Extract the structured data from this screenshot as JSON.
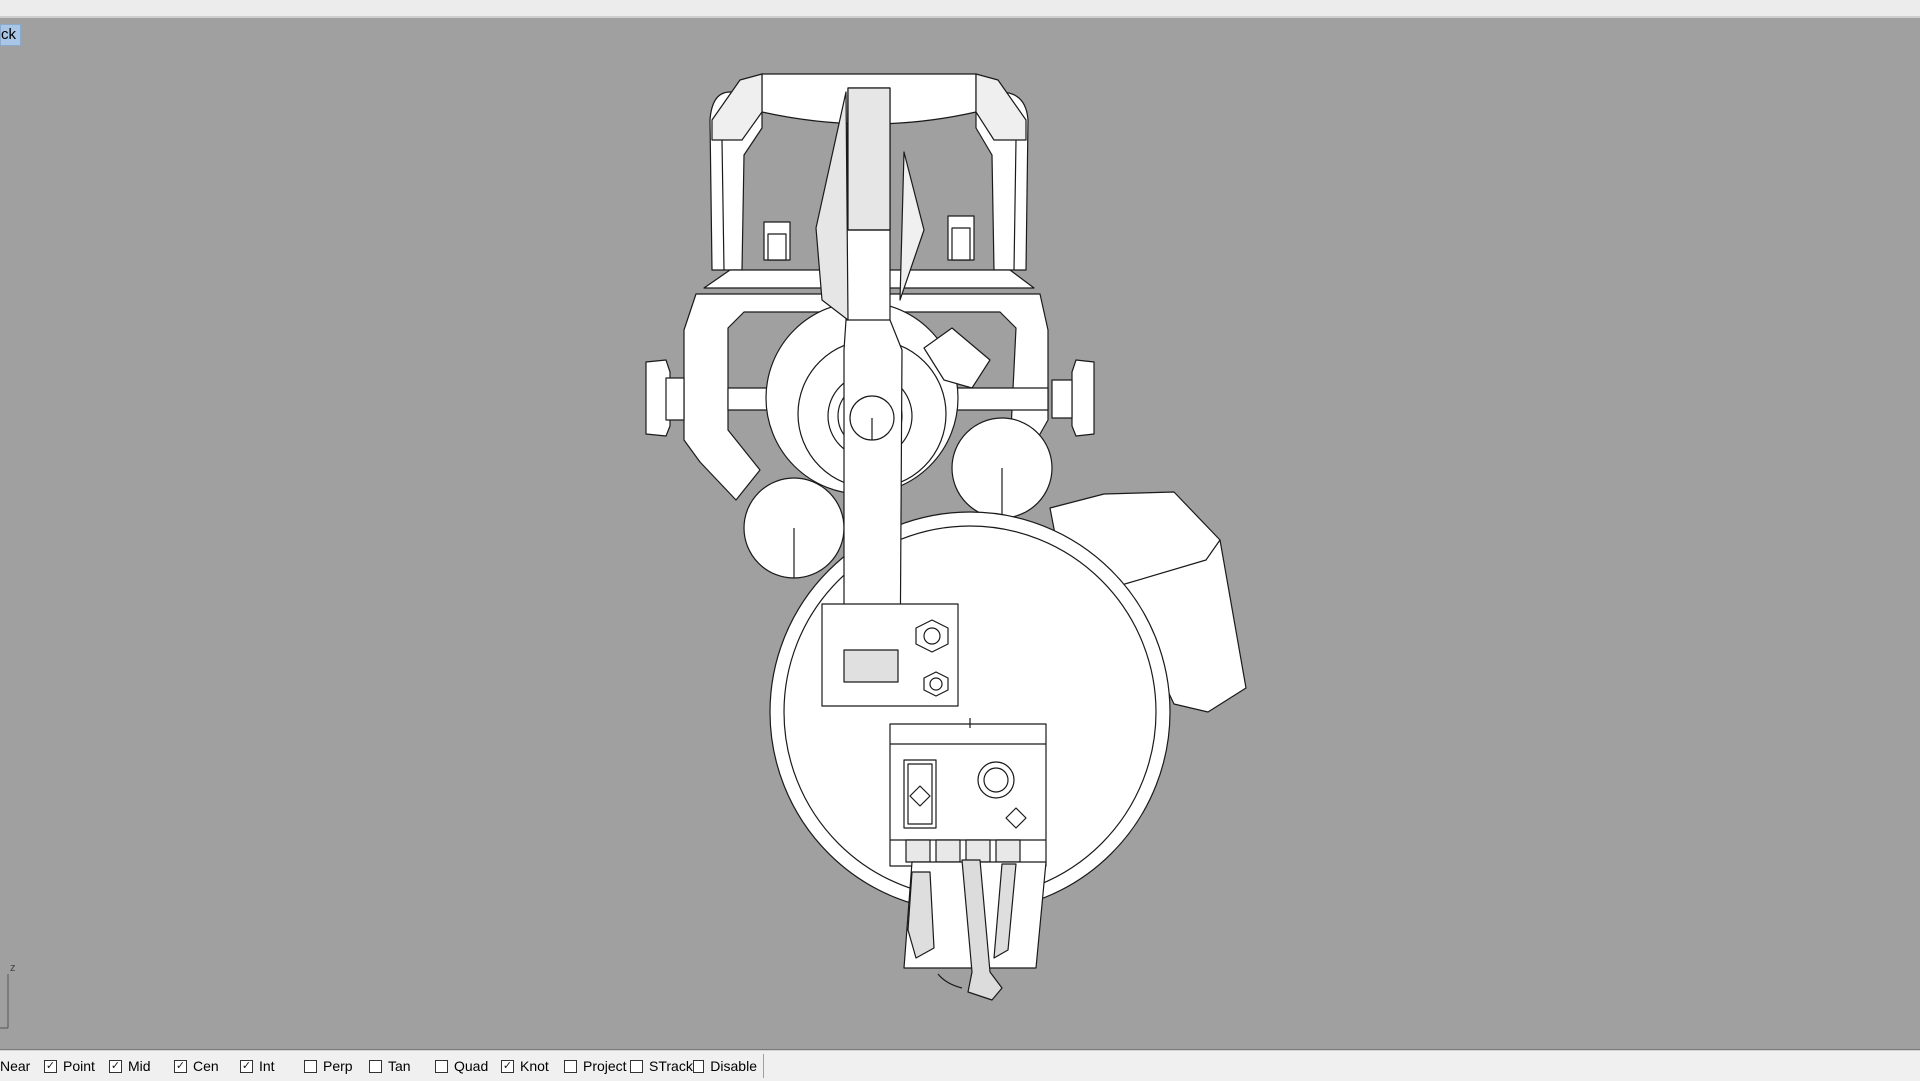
{
  "viewport": {
    "title": "ck",
    "axis_label": "z",
    "background_color": "#a0a0a0"
  },
  "osnap": {
    "items": [
      {
        "label": "Near",
        "checked": false,
        "has_box": false
      },
      {
        "label": "Point",
        "checked": true,
        "has_box": true
      },
      {
        "label": "Mid",
        "checked": true,
        "has_box": true
      },
      {
        "label": "Cen",
        "checked": true,
        "has_box": true
      },
      {
        "label": "Int",
        "checked": true,
        "has_box": true
      },
      {
        "label": "Perp",
        "checked": false,
        "has_box": true
      },
      {
        "label": "Tan",
        "checked": false,
        "has_box": true
      },
      {
        "label": "Quad",
        "checked": false,
        "has_box": true
      },
      {
        "label": "Knot",
        "checked": true,
        "has_box": true
      },
      {
        "label": "Project",
        "checked": false,
        "has_box": true
      },
      {
        "label": "STrack",
        "checked": false,
        "has_box": true
      },
      {
        "label": "Disable",
        "checked": false,
        "has_box": true
      }
    ]
  }
}
